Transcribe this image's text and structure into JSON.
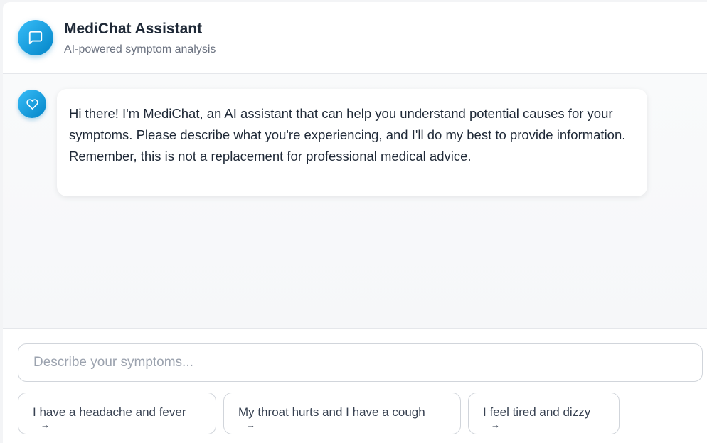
{
  "header": {
    "title": "MediChat Assistant",
    "subtitle": "AI-powered symptom analysis",
    "icon": "chat-bubble-icon"
  },
  "chat": {
    "messages": [
      {
        "sender": "bot",
        "avatar_icon": "heart-icon",
        "text": "Hi there! I'm MediChat, an AI assistant that can help you understand potential causes for your symptoms. Please describe what you're experiencing, and I'll do my best to provide information. Remember, this is not a replacement for professional medical advice."
      }
    ]
  },
  "composer": {
    "placeholder": "Describe your symptoms...",
    "value": "",
    "suggestions": [
      {
        "label": "I have a headache and fever",
        "arrow": "→"
      },
      {
        "label": "My throat hurts and I have a cough",
        "arrow": "→"
      },
      {
        "label": "I feel tired and dizzy",
        "arrow": "→"
      }
    ]
  },
  "colors": {
    "accent_start": "#38bdf8",
    "accent_end": "#0284c7",
    "text_primary": "#1f2937",
    "text_muted": "#6b7280",
    "border": "#d1d5db"
  }
}
